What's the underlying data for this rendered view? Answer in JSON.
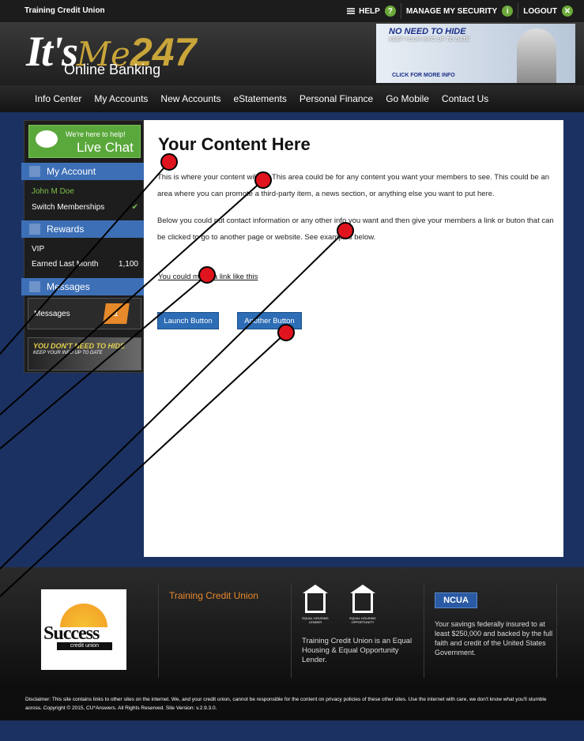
{
  "topbar": {
    "site_name": "Training Credit Union",
    "help": "HELP",
    "security": "MANAGE MY SECURITY",
    "logout": "LOGOUT"
  },
  "header": {
    "logo_its": "It's",
    "logo_me": "Me",
    "logo_num": "247",
    "logo_sub": "Online Banking",
    "banner_line1": "NO NEED TO HIDE",
    "banner_line2": "KEEP YOUR INFO UP TO DATE",
    "banner_cta": "CLICK FOR MORE INFO"
  },
  "nav": {
    "items": [
      "Info Center",
      "My Accounts",
      "New Accounts",
      "eStatements",
      "Personal Finance",
      "Go Mobile",
      "Contact Us"
    ]
  },
  "sidebar": {
    "livechat_top": "We're here to help!",
    "livechat_main": "Live Chat",
    "my_account": "My Account",
    "member_name": "John M Doe",
    "switch": "Switch Memberships",
    "rewards": "Rewards",
    "tier": "VIP",
    "earned_label": "Earned Last Month",
    "earned_value": "1,100",
    "messages_head": "Messages",
    "messages_label": "Messages",
    "messages_count": "1",
    "promo_line1": "YOU DON'T NEED TO HIDE",
    "promo_line2": "KEEP YOUR INFO UP TO DATE"
  },
  "content": {
    "title": "Your Content Here",
    "p1": "This is where your content will go.  This area could be for any content you want your members to see.  This could be an area where you can promote a third-party item, a news section, or anything else you want to put here.",
    "p2": "Below you could put contact information or any other info you want and then give your members a link or buton that can be clicked to go to another page or website. See examples below.",
    "link": "You could make a link like this",
    "btn1": "Launch Button",
    "btn2": "Another Button"
  },
  "footer": {
    "logo_word": "Success",
    "logo_sub": "credit union",
    "cu_name": "Training Credit Union",
    "eh_cap1": "EQUAL HOUSING LENDER",
    "eh_cap2": "EQUAL HOUSING OPPORTUNITY",
    "eh_text": "Training Credit Union is an Equal Housing & Equal Opportunity Lender.",
    "ncua": "NCUA",
    "ncua_text": "Your savings federally insured to at least $250,000 and backed by the full faith and credit of the United States Government."
  },
  "disclaimer": "Disclaimer: This site contains links to other sites on the internet. We, and your credit union, cannot be responsible for the content on privacy policies of these other sites. Use the internet with care, we don't know what you'll stumble across. Copyright © 2015, CU*Answers. All Rights Reserved. Site Version: v.2.9.3.0.",
  "colors": {
    "accent_blue": "#3d6fb6",
    "button_blue": "#2d6db5",
    "chat_green": "#5aa83b",
    "footer_orange": "#e8892d",
    "marker_red": "#e0141e"
  }
}
